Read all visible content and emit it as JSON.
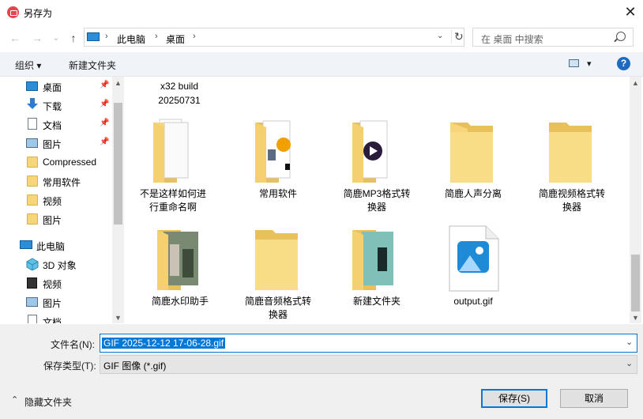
{
  "window": {
    "title": "另存为",
    "close_label": "✕"
  },
  "nav": {
    "back": "←",
    "forward": "→",
    "recent": "⌄",
    "up": "↑",
    "address": [
      "此电脑",
      "桌面"
    ],
    "address_sep": "›",
    "address_dropdown": "⌄",
    "refresh": "↻",
    "search_placeholder": "在 桌面 中搜索"
  },
  "toolbar": {
    "organize": "组织 ▾",
    "new_folder": "新建文件夹",
    "view_dropdown": "▾",
    "help": "?"
  },
  "sidebar": {
    "items": [
      {
        "label": "桌面",
        "pinned": true,
        "icon": "desktop-icon"
      },
      {
        "label": "下载",
        "pinned": true,
        "icon": "download-icon"
      },
      {
        "label": "文档",
        "pinned": true,
        "icon": "document-icon"
      },
      {
        "label": "图片",
        "pinned": true,
        "icon": "picture-icon"
      },
      {
        "label": "Compressed",
        "pinned": false,
        "icon": "folder-icon"
      },
      {
        "label": "常用软件",
        "pinned": false,
        "icon": "folder-icon"
      },
      {
        "label": "视频",
        "pinned": false,
        "icon": "folder-icon"
      },
      {
        "label": "图片",
        "pinned": false,
        "icon": "folder-icon"
      },
      {
        "label": "此电脑",
        "pinned": false,
        "icon": "computer-icon"
      },
      {
        "label": "3D 对象",
        "pinned": false,
        "icon": "3d-objects-icon"
      },
      {
        "label": "视频",
        "pinned": false,
        "icon": "video-icon"
      },
      {
        "label": "图片",
        "pinned": false,
        "icon": "picture-icon"
      },
      {
        "label": "文档",
        "pinned": false,
        "icon": "document-icon"
      }
    ],
    "pin_glyph": "📌"
  },
  "files": [
    {
      "line1": "x32 build",
      "line2": "20250731"
    },
    {
      "line1": "不是这样如何进",
      "line2": "行重命名啊"
    },
    {
      "line1": "常用软件",
      "line2": ""
    },
    {
      "line1": "简鹿MP3格式转",
      "line2": "换器"
    },
    {
      "line1": "简鹿人声分离",
      "line2": ""
    },
    {
      "line1": "简鹿视频格式转",
      "line2": "换器"
    },
    {
      "line1": "简鹿水印助手",
      "line2": ""
    },
    {
      "line1": "简鹿音频格式转",
      "line2": "换器"
    },
    {
      "line1": "新建文件夹",
      "line2": ""
    },
    {
      "line1": "output.gif",
      "line2": ""
    }
  ],
  "save": {
    "filename_label": "文件名(N):",
    "filename_value": "GIF 2025-12-12 17-06-28.gif",
    "type_label": "保存类型(T):",
    "type_value": "GIF 图像 (*.gif)",
    "hide_folders": "隐藏文件夹",
    "save_button": "保存(S)",
    "cancel_button": "取消",
    "dropdown_glyph": "⌄",
    "hide_glyph": "⌃"
  },
  "scroll": {
    "up": "▲",
    "down": "▼"
  },
  "colors": {
    "accent": "#0078d7",
    "folder": "#f7d57a",
    "app_icon": "#e8434f"
  }
}
